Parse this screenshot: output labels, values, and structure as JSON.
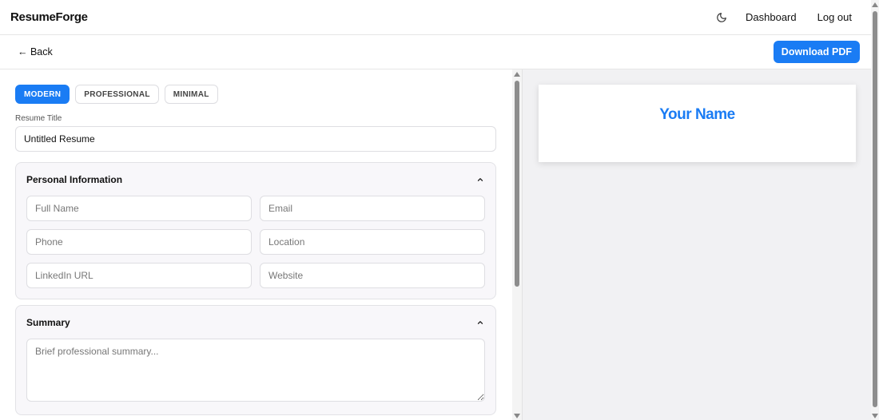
{
  "app": {
    "brand": "ResumeForge"
  },
  "nav": {
    "theme_icon": "moon-icon",
    "dashboard": "Dashboard",
    "logout": "Log out"
  },
  "toolbar": {
    "back": "← Back",
    "download": "Download PDF"
  },
  "templates": [
    {
      "label": "MODERN",
      "active": true
    },
    {
      "label": "PROFESSIONAL",
      "active": false
    },
    {
      "label": "MINIMAL",
      "active": false
    }
  ],
  "resume_title": {
    "label": "Resume Title",
    "value": "Untitled Resume"
  },
  "personal": {
    "title": "Personal Information",
    "fields": {
      "full_name": "Full Name",
      "email": "Email",
      "phone": "Phone",
      "location": "Location",
      "linkedin": "LinkedIn URL",
      "website": "Website"
    }
  },
  "summary": {
    "title": "Summary",
    "placeholder": "Brief professional summary..."
  },
  "preview": {
    "name": "Your Name"
  },
  "colors": {
    "accent": "#1a7cf4",
    "preview_bg": "#f1f1f3",
    "section_bg": "#f8f7fa"
  }
}
